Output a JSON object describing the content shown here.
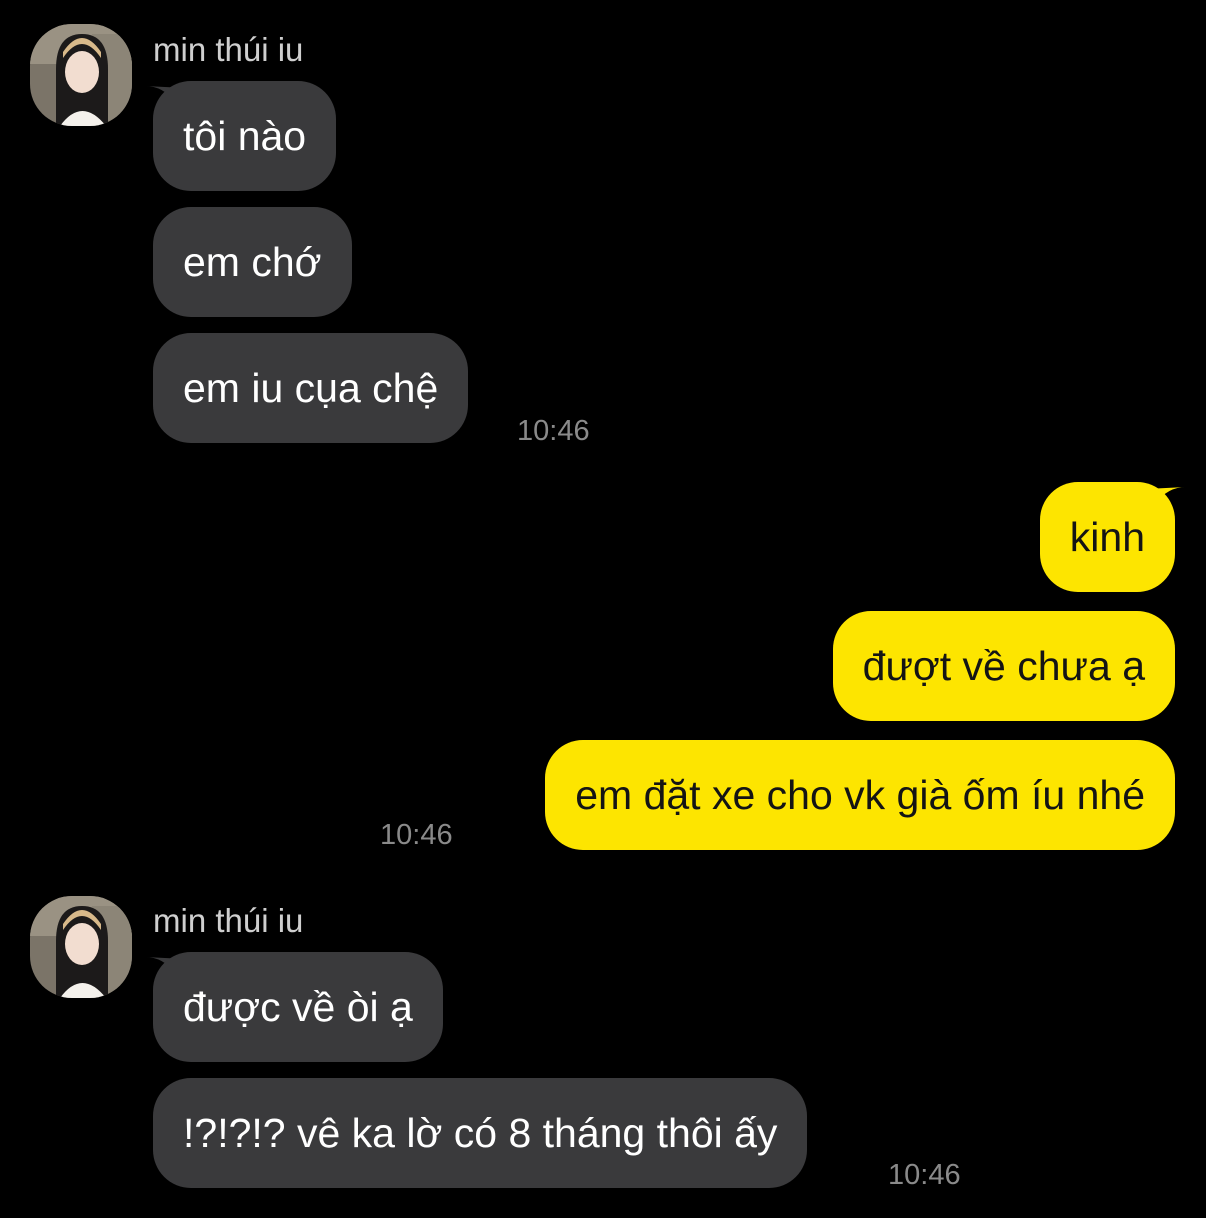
{
  "colors": {
    "background": "#000000",
    "incoming_bubble": "#3a3a3c",
    "outgoing_bubble": "#fde500",
    "timestamp": "#8a8a8a"
  },
  "group1": {
    "avatar_icon": "profile-photo-avatar",
    "sender": "min thúi iu",
    "messages": [
      "tôi nào",
      "em chớ",
      "em iu cụa chệ"
    ],
    "time": "10:46"
  },
  "group2": {
    "messages": [
      "kinh",
      "đượt về chưa ạ",
      "em đặt xe cho vk già ốm íu nhé"
    ],
    "time": "10:46"
  },
  "group3": {
    "avatar_icon": "profile-photo-avatar",
    "sender": "min thúi iu",
    "messages": [
      "được về òi ạ",
      "!?!?!? vê ka lờ có 8 tháng thôi ấy"
    ],
    "time": "10:46"
  }
}
